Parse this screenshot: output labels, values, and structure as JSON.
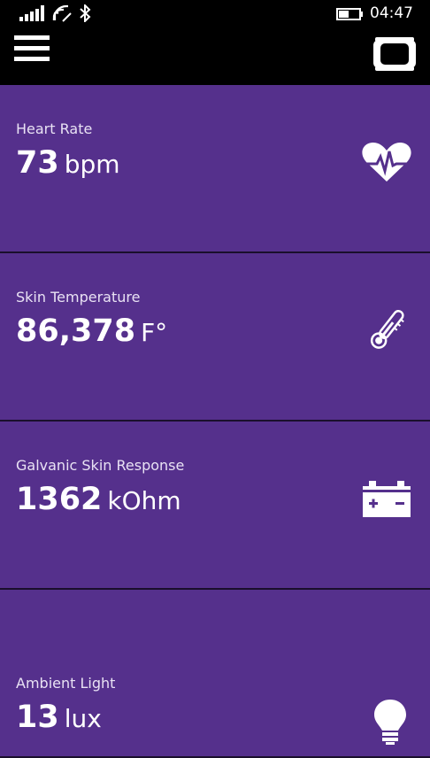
{
  "status_bar": {
    "time": "04:47",
    "icons": [
      "signal-icon",
      "wifi-icon",
      "bluetooth-icon",
      "battery-icon"
    ]
  },
  "app_bar": {
    "icons": [
      "menu-icon",
      "band-device-icon"
    ]
  },
  "colors": {
    "tile_background": "#55308c",
    "divider": "#1a0f2c",
    "top_bar": "#000000",
    "text": "#ffffff"
  },
  "tiles": [
    {
      "label": "Heart Rate",
      "value": "73",
      "unit": "bpm",
      "icon": "heart-rate-icon"
    },
    {
      "label": "Skin Temperature",
      "value": "86,378",
      "unit": "F°",
      "icon": "thermometer-icon"
    },
    {
      "label": "Galvanic Skin Response",
      "value": "1362",
      "unit": "kOhm",
      "icon": "battery-gsr-icon"
    },
    {
      "label": "Ambient Light",
      "value": "13",
      "unit": "lux",
      "icon": "light-bulb-icon"
    }
  ]
}
